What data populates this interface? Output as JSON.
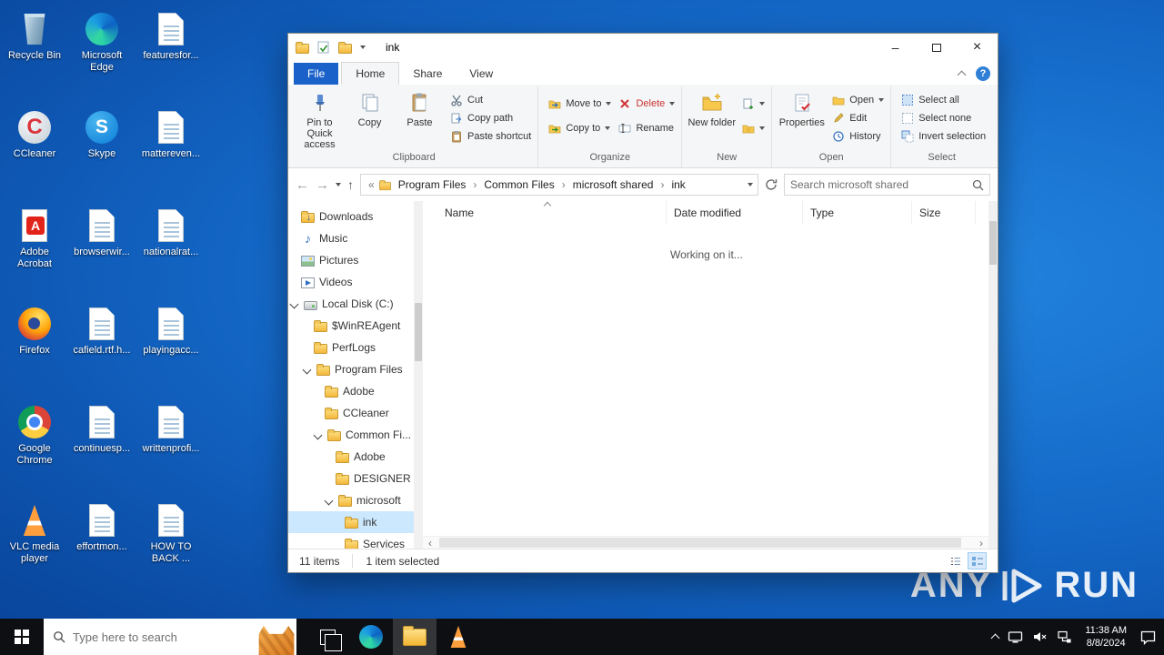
{
  "colors": {
    "desktop_blue": "#1365c4",
    "accent_blue": "#1a62c9",
    "selection_blue": "#cce8ff",
    "delete_red": "#d13438",
    "folder_yellow": "#f2b632",
    "taskbar_black": "#0e0f12"
  },
  "icons": {
    "back": "←",
    "forward": "→",
    "up": "↑",
    "overflow": "«",
    "crumb_sep": "›",
    "help": "?",
    "minimize": "–",
    "close": "×",
    "scroll_left": "‹",
    "scroll_right": "›",
    "music_note": "♪"
  },
  "desktop": {
    "icons": [
      {
        "label": "Recycle Bin",
        "kind": "recycle-bin"
      },
      {
        "label": "Microsoft Edge",
        "kind": "edge"
      },
      {
        "label": "featuresfor...",
        "kind": "document"
      },
      {
        "label": "CCleaner",
        "kind": "ccleaner"
      },
      {
        "label": "Skype",
        "kind": "skype"
      },
      {
        "label": "mattereven...",
        "kind": "document"
      },
      {
        "label": "Adobe Acrobat",
        "kind": "acrobat"
      },
      {
        "label": "browserwir...",
        "kind": "document"
      },
      {
        "label": "nationalrat...",
        "kind": "document"
      },
      {
        "label": "Firefox",
        "kind": "firefox"
      },
      {
        "label": "cafield.rtf.h...",
        "kind": "document"
      },
      {
        "label": "playingacc...",
        "kind": "document"
      },
      {
        "label": "Google Chrome",
        "kind": "chrome"
      },
      {
        "label": "continuesp...",
        "kind": "document"
      },
      {
        "label": "writtenprofi...",
        "kind": "document"
      },
      {
        "label": "VLC media player",
        "kind": "vlc"
      },
      {
        "label": "effortmon...",
        "kind": "document"
      },
      {
        "label": "HOW TO BACK ...",
        "kind": "document"
      }
    ],
    "watermark": {
      "left": "ANY",
      "right": "RUN"
    }
  },
  "explorer": {
    "title": "ink",
    "tabs": {
      "file": "File",
      "home": "Home",
      "share": "Share",
      "view": "View"
    },
    "ribbon": {
      "clipboard": {
        "label": "Clipboard",
        "pin_to_quick_access": "Pin to Quick access",
        "copy": "Copy",
        "paste": "Paste",
        "cut": "Cut",
        "copy_path": "Copy path",
        "paste_shortcut": "Paste shortcut"
      },
      "organize": {
        "label": "Organize",
        "move_to": "Move to",
        "copy_to": "Copy to",
        "delete": "Delete",
        "rename": "Rename"
      },
      "new": {
        "label": "New",
        "new_folder": "New folder"
      },
      "open": {
        "label": "Open",
        "properties": "Properties",
        "open": "Open",
        "edit": "Edit",
        "history": "History"
      },
      "select": {
        "label": "Select",
        "select_all": "Select all",
        "select_none": "Select none",
        "invert_selection": "Invert selection"
      }
    },
    "address": {
      "crumbs": [
        "Program Files",
        "Common Files",
        "microsoft shared",
        "ink"
      ]
    },
    "search": {
      "placeholder": "Search microsoft shared"
    },
    "nav": [
      {
        "label": "Downloads"
      },
      {
        "label": "Music"
      },
      {
        "label": "Pictures"
      },
      {
        "label": "Videos"
      },
      {
        "label": "Local Disk (C:)"
      },
      {
        "label": "$WinREAgent"
      },
      {
        "label": "PerfLogs"
      },
      {
        "label": "Program Files"
      },
      {
        "label": "Adobe"
      },
      {
        "label": "CCleaner"
      },
      {
        "label": "Common Fi..."
      },
      {
        "label": "Adobe"
      },
      {
        "label": "DESIGNER"
      },
      {
        "label": "microsoft"
      },
      {
        "label": "ink",
        "selected": true
      },
      {
        "label": "Services"
      }
    ],
    "files": {
      "columns": [
        "Name",
        "Date modified",
        "Type",
        "Size"
      ],
      "message": "Working on it..."
    },
    "status": {
      "items": "11 items",
      "selected": "1 item selected"
    }
  },
  "taskbar": {
    "search_placeholder": "Type here to search",
    "clock_time": "11:38 AM",
    "clock_date": "8/8/2024"
  }
}
